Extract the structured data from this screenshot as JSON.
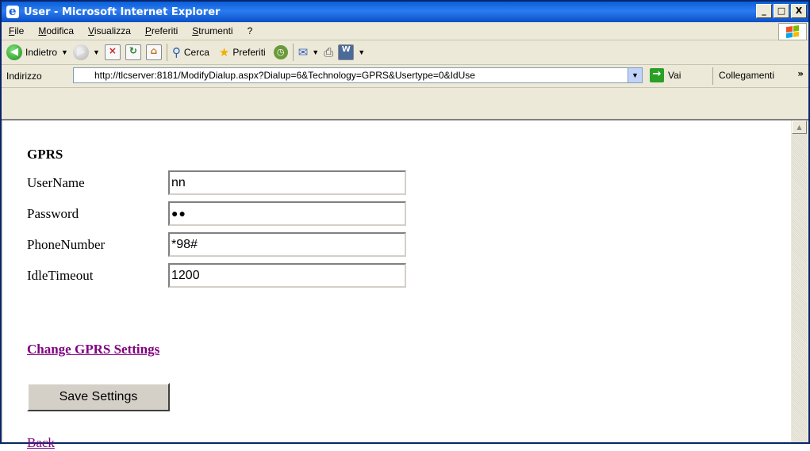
{
  "window": {
    "title": "User - Microsoft Internet Explorer",
    "buttons": [
      "_",
      "□",
      "X"
    ]
  },
  "menu": [
    "File",
    "Modifica",
    "Visualizza",
    "Preferiti",
    "Strumenti",
    "?"
  ],
  "toolbar": {
    "back": "Indietro",
    "search": "Cerca",
    "favorites": "Preferiti"
  },
  "address": {
    "label": "Indirizzo",
    "url": "http://tlcserver:8181/ModifyDialup.aspx?Dialup=6&Technology=GPRS&Usertype=0&IdUse",
    "go": "Vai",
    "links": "Collegamenti"
  },
  "page": {
    "heading": "GPRS",
    "fields": [
      {
        "label": "UserName",
        "value": "nn"
      },
      {
        "label": "Password",
        "value": "●●"
      },
      {
        "label": "PhoneNumber",
        "value": "*98#"
      },
      {
        "label": "IdleTimeout",
        "value": "1200"
      }
    ],
    "change_link": "Change GPRS Settings",
    "save_button": "Save Settings",
    "back_link": "Back"
  }
}
